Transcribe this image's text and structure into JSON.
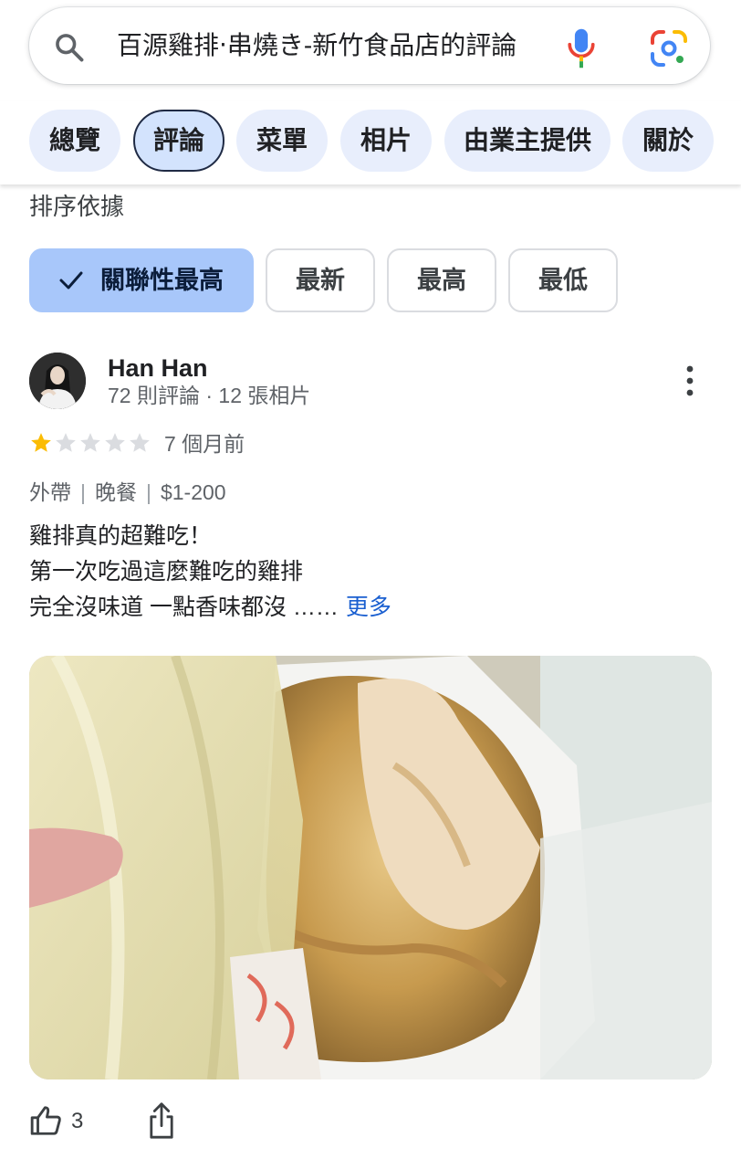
{
  "search": {
    "query": "百源雞排‧串燒き-新竹食品店的評論"
  },
  "tabs": [
    {
      "label": "總覽"
    },
    {
      "label": "評論"
    },
    {
      "label": "菜單"
    },
    {
      "label": "相片"
    },
    {
      "label": "由業主提供"
    },
    {
      "label": "關於"
    }
  ],
  "active_tab": "評論",
  "sort": {
    "label": "排序依據",
    "options": [
      {
        "label": "關聯性最高",
        "selected": true
      },
      {
        "label": "最新"
      },
      {
        "label": "最高"
      },
      {
        "label": "最低"
      }
    ]
  },
  "review": {
    "author": "Han Han",
    "meta": "72 則評論 · 12 張相片",
    "rating": 1,
    "max_rating": 5,
    "time_ago": "7 個月前",
    "tags": [
      "外帶",
      "晚餐",
      "$1-200"
    ],
    "lines": [
      "雞排真的超難吃！",
      "第一次吃過這麼難吃的雞排",
      "完全沒味道 一點香味都沒 ……"
    ],
    "more_label": "更多",
    "likes": "3"
  },
  "colors": {
    "accent": "#1a5fd0",
    "star_filled": "#fbbc04",
    "star_empty": "#dadce0",
    "chip_selected": "#a8c7fa",
    "tab_bg": "#e8eefc"
  }
}
